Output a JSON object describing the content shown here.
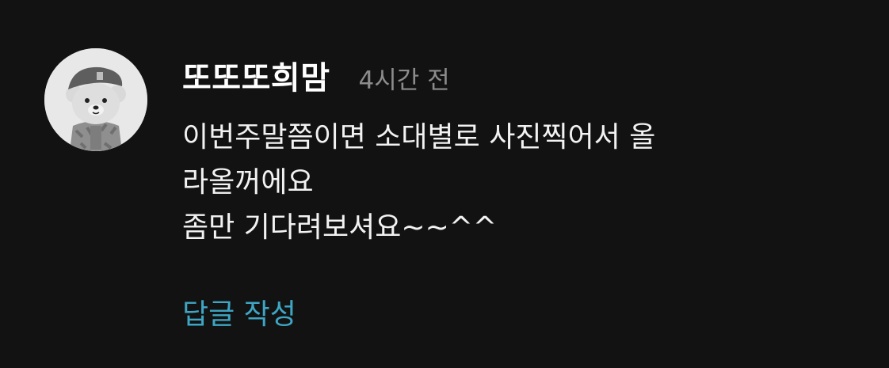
{
  "comment": {
    "author": "또또또희맘",
    "timestamp": "4시간 전",
    "text": "이번주말쯤이면 소대별로 사진찍어서 올\n라올꺼에요\n좀만 기다려보셔요~~^^",
    "reply_label": "답글 작성",
    "avatar_icon": "bear-soldier-avatar-icon"
  },
  "colors": {
    "background": "#121212",
    "reply_link": "#3ea6c4",
    "timestamp": "#8c8c8c"
  }
}
